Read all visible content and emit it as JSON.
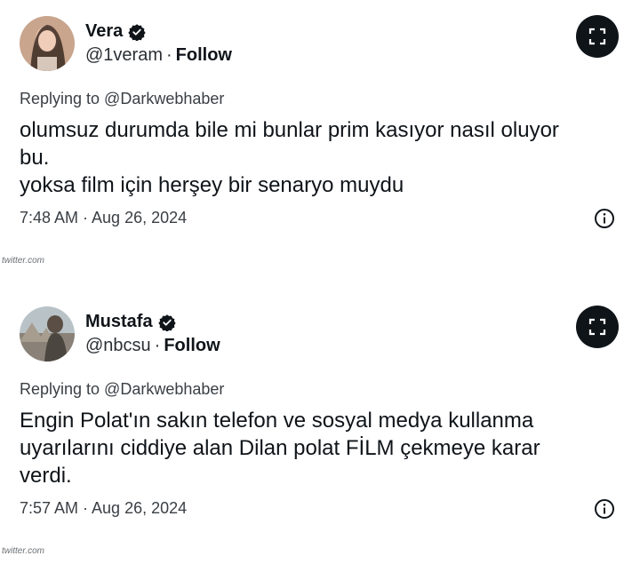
{
  "tweets": [
    {
      "name": "Vera",
      "handle": "@1veram",
      "separator": "·",
      "follow_label": "Follow",
      "replying_to": "Replying to @Darkwebhaber",
      "body_lines": [
        "olumsuz durumda bile mi bunlar prim kasıyor nasıl oluyor",
        "bu.",
        "yoksa film için herşey bir senaryo muydu"
      ],
      "timestamp": "7:48 AM · Aug 26, 2024",
      "source": "twitter.com",
      "icons": [
        "avatar",
        "verified-badge-icon",
        "expand-icon",
        "info-icon"
      ]
    },
    {
      "name": "Mustafa",
      "handle": "@nbcsu",
      "separator": "·",
      "follow_label": "Follow",
      "replying_to": "Replying to @Darkwebhaber",
      "body_lines": [
        "Engin Polat'ın sakın telefon ve sosyal medya kullanma",
        "uyarılarını ciddiye alan Dilan polat FİLM çekmeye karar",
        "verdi."
      ],
      "timestamp": "7:57 AM · Aug 26, 2024",
      "source": "twitter.com",
      "icons": [
        "avatar",
        "verified-badge-icon",
        "expand-icon",
        "info-icon"
      ]
    }
  ],
  "colors": {
    "text": "#0f1419",
    "secondary": "#3a3f44",
    "expand_bg": "#0f1419"
  }
}
